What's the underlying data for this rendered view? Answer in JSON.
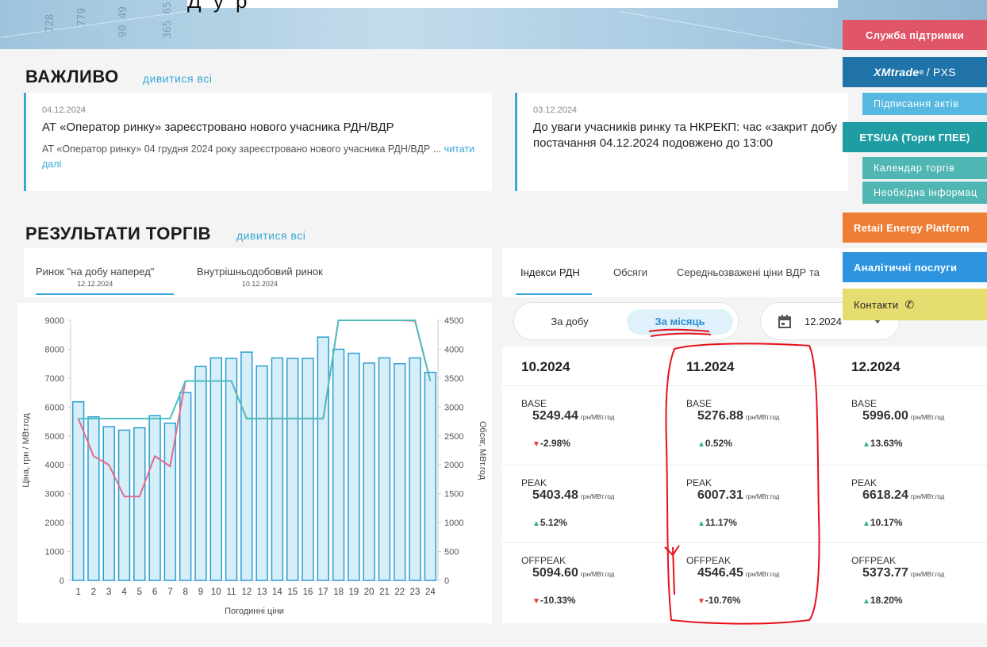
{
  "header_overlay": "Д                   у                                                        р",
  "banner_numbers": [
    "728",
    "779",
    "90 49",
    "365 65"
  ],
  "important": {
    "title": "ВАЖЛИВО",
    "see_all": "дивитися всі"
  },
  "news": [
    {
      "date": "04.12.2024",
      "headline": "АТ «Оператор ринку» зареєстровано нового учасника РДН/ВДР",
      "body": "АТ «Оператор ринку» 04 грудня 2024 року зареєстровано нового учасника РДН/ВДР ...",
      "more": "читати далі"
    },
    {
      "date": "03.12.2024",
      "headline": "До уваги учасників ринку та НКРЕКП: час «закрит добу постачання 04.12.2024 подовжено до 13:00"
    }
  ],
  "results": {
    "title": "РЕЗУЛЬТАТИ ТОРГІВ",
    "see_all": "дивитися всі"
  },
  "market_tabs": [
    {
      "label": "Ринок \"на добу наперед\"",
      "date": "12.12.2024"
    },
    {
      "label": "Внутрішньодобовий ринок",
      "date": "10.12.2024"
    }
  ],
  "index_tabs": [
    "Індекси РДН",
    "Обсяги",
    "Середньозважені ціни ВДР та"
  ],
  "period_toggle": {
    "day": "За добу",
    "month": "За місяць"
  },
  "date_picker": {
    "value": "12.2024"
  },
  "unit": "грн/МВт.год",
  "months": [
    {
      "name": "10.2024",
      "rows": [
        {
          "label": "BASE",
          "value": "5249.44",
          "change": "-2.98%",
          "dir": "down"
        },
        {
          "label": "PEAK",
          "value": "5403.48",
          "change": "5.12%",
          "dir": "up"
        },
        {
          "label": "OFFPEAK",
          "value": "5094.60",
          "change": "-10.33%",
          "dir": "down"
        }
      ]
    },
    {
      "name": "11.2024",
      "rows": [
        {
          "label": "BASE",
          "value": "5276.88",
          "change": "0.52%",
          "dir": "up"
        },
        {
          "label": "PEAK",
          "value": "6007.31",
          "change": "11.17%",
          "dir": "up"
        },
        {
          "label": "OFFPEAK",
          "value": "4546.45",
          "change": "-10.76%",
          "dir": "down"
        }
      ]
    },
    {
      "name": "12.2024",
      "rows": [
        {
          "label": "BASE",
          "value": "5996.00",
          "change": "13.63%",
          "dir": "up"
        },
        {
          "label": "PEAK",
          "value": "6618.24",
          "change": "10.17%",
          "dir": "up"
        },
        {
          "label": "OFFPEAK",
          "value": "5373.77",
          "change": "18.20%",
          "dir": "up"
        }
      ]
    }
  ],
  "sidebar": {
    "support": "Служба підтримки",
    "xmtrade_brand": "XMtrade",
    "xmtrade_reg": "®",
    "xmtrade_suffix": "/ PXS",
    "signing": "Підписання актів",
    "ets": "ETS/UA (Торги ГПЕЕ)",
    "calendar": "Календар торгів",
    "info": "Необхідна інформац",
    "retail": "Retail Energy Platform",
    "analytics": "Аналітичні послуги",
    "contacts": "Контакти"
  },
  "colors": {
    "accent": "#3aa7d6",
    "bar_fill": "#d6eef8",
    "bar_stroke": "#2b9fd4",
    "price_line": "#e46b8c",
    "volume_line": "#4dbfc1",
    "annotation": "#e8101a"
  },
  "chart_data": {
    "type": "bar",
    "x": [
      1,
      2,
      3,
      4,
      5,
      6,
      7,
      8,
      9,
      10,
      11,
      12,
      13,
      14,
      15,
      16,
      17,
      18,
      19,
      20,
      21,
      22,
      23,
      24
    ],
    "xlabel": "Погодинні ціни",
    "ylabel": "Ціна, грн / МВт.год",
    "y2label": "Обсяг, МВт.год",
    "ylim": [
      0,
      9000
    ],
    "y2lim": [
      0,
      4500
    ],
    "yticks": [
      0,
      1000,
      2000,
      3000,
      4000,
      5000,
      6000,
      7000,
      8000,
      9000
    ],
    "y2ticks": [
      0,
      500,
      1000,
      1500,
      2000,
      2500,
      3000,
      3500,
      4000,
      4500
    ],
    "grid": false,
    "series": [
      {
        "kind": "bar",
        "axis": "y2",
        "values": [
          3090,
          2830,
          2660,
          2600,
          2640,
          2850,
          2720,
          3250,
          3700,
          3850,
          3840,
          3950,
          3710,
          3850,
          3840,
          3840,
          4210,
          4000,
          3930,
          3760,
          3850,
          3750,
          3850,
          3600
        ]
      },
      {
        "kind": "line",
        "axis": "y",
        "values": [
          5600,
          4300,
          4000,
          2900,
          2900,
          4300,
          3950,
          6900,
          6900,
          6900,
          6900,
          5600,
          5600,
          5600,
          5600,
          5600,
          5600,
          9000,
          9000,
          9000,
          9000,
          9000,
          8980,
          6900
        ]
      },
      {
        "kind": "line",
        "axis": "y",
        "values": [
          5600,
          5600,
          5600,
          5600,
          5600,
          5600,
          5600,
          6900,
          6900,
          6900,
          6900,
          5600,
          5600,
          5600,
          5600,
          5600,
          5600,
          9000,
          9000,
          9000,
          9000,
          9000,
          9000,
          6900
        ]
      }
    ]
  }
}
